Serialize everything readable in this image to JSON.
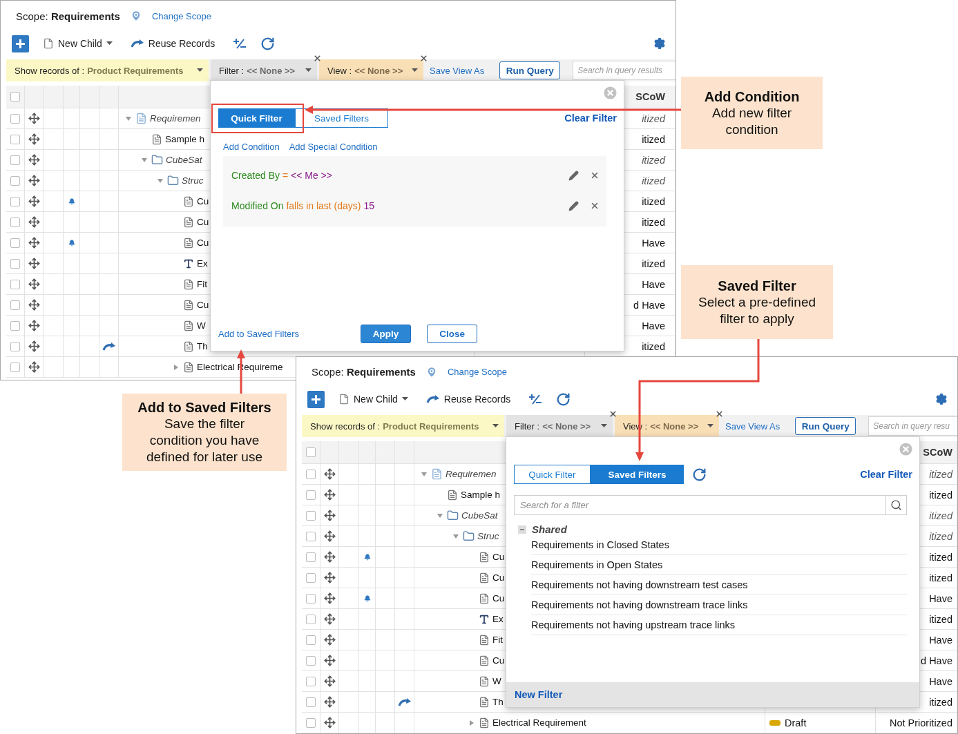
{
  "screens": [
    {
      "scope": "Scope: **Requirements**",
      "change_scope": "Change Scope",
      "new_child": "New Child",
      "reuse_records": "Reuse Records",
      "filter_bar": {
        "show_label": "Show records of :",
        "show_value": "Product Requirements",
        "filter_label": "Filter :",
        "filter_value": "<< None >>",
        "view_label": "View :",
        "view_value": "<< None >>",
        "save_view_as": "Save View As",
        "run_query": "Run Query",
        "search_placeholder": "Search in query results"
      },
      "select_all_checked": false,
      "column_header": "SCoW",
      "tree": [
        {
          "kind": "collection",
          "title": "Requiremen",
          "expanded": true,
          "checked": false,
          "priority": "itized",
          "children": [
            {
              "kind": "document",
              "title": "Sample h",
              "checked": false,
              "priority": "itized"
            },
            {
              "kind": "folder",
              "title": "CubeSat",
              "expanded": true,
              "checked": false,
              "priority": "itized",
              "children": [
                {
                  "kind": "folder",
                  "title": "Struc",
                  "expanded": true,
                  "checked": false,
                  "priority": "itized",
                  "children": [
                    {
                      "kind": "document",
                      "title": "Cu",
                      "checked": false,
                      "alert": true,
                      "priority": "itized"
                    },
                    {
                      "kind": "document",
                      "title": "Cu",
                      "checked": false,
                      "priority": "itized"
                    },
                    {
                      "kind": "document",
                      "title": "Cu",
                      "checked": false,
                      "alert": true,
                      "priority": "Have"
                    },
                    {
                      "kind": "text",
                      "title": "Ex",
                      "checked": false,
                      "priority": "itized"
                    },
                    {
                      "kind": "document",
                      "title": "Fit",
                      "checked": false,
                      "priority": "Have"
                    },
                    {
                      "kind": "document",
                      "title": "Cu",
                      "checked": false,
                      "priority": "d Have"
                    },
                    {
                      "kind": "document",
                      "title": "W",
                      "checked": false,
                      "priority": "Have"
                    },
                    {
                      "kind": "document",
                      "title": "Th",
                      "checked": false,
                      "reused": true,
                      "priority": "itized"
                    },
                    {
                      "kind": "document",
                      "title": "Electrical Requireme",
                      "expanded": false,
                      "checked": false
                    }
                  ]
                }
              ]
            }
          ]
        }
      ],
      "popup": {
        "kind": "quick",
        "tabs": [
          {
            "label": "Quick Filter",
            "selected": true
          },
          {
            "label": "Saved Filters",
            "selected": false
          }
        ],
        "clear_filter": "Clear Filter",
        "links": [
          "Add Condition",
          "Add Special Condition"
        ],
        "conditions": [
          {
            "field": "Created By",
            "operator": "=",
            "value": "<< Me >>"
          },
          {
            "field": "Modified On",
            "operator": "falls in last (days)",
            "value": "15"
          }
        ],
        "add_to_saved": "Add to Saved Filters",
        "buttons": [
          {
            "label": "Apply",
            "primary": true
          },
          {
            "label": "Close",
            "primary": false
          }
        ]
      }
    },
    {
      "scope": "Scope: **Requirements**",
      "change_scope": "Change Scope",
      "new_child": "New Child",
      "reuse_records": "Reuse Records",
      "filter_bar": {
        "show_label": "Show records of :",
        "show_value": "Product Requirements",
        "filter_label": "Filter :",
        "filter_value": "<< None >>",
        "view_label": "View :",
        "view_value": "<< None >>",
        "save_view_as": "Save View As",
        "run_query": "Run Query",
        "search_placeholder": "Search in query resu"
      },
      "select_all_checked": false,
      "column_header": "SCoW",
      "tree": [
        {
          "kind": "collection",
          "title": "Requiremen",
          "expanded": true,
          "checked": false,
          "priority": "itized",
          "children": [
            {
              "kind": "document",
              "title": "Sample h",
              "checked": false,
              "priority": "itized"
            },
            {
              "kind": "folder",
              "title": "CubeSat",
              "expanded": true,
              "checked": false,
              "priority": "itized",
              "children": [
                {
                  "kind": "folder",
                  "title": "Struc",
                  "expanded": true,
                  "checked": false,
                  "priority": "itized",
                  "children": [
                    {
                      "kind": "document",
                      "title": "Cu",
                      "checked": false,
                      "alert": true,
                      "priority": "itized"
                    },
                    {
                      "kind": "document",
                      "title": "Cu",
                      "checked": false,
                      "priority": "itized"
                    },
                    {
                      "kind": "document",
                      "title": "Cu",
                      "checked": false,
                      "alert": true,
                      "priority": "Have"
                    },
                    {
                      "kind": "text",
                      "title": "Ex",
                      "checked": false,
                      "priority": "itized"
                    },
                    {
                      "kind": "document",
                      "title": "Fit",
                      "checked": false,
                      "priority": "Have"
                    },
                    {
                      "kind": "document",
                      "title": "Cu",
                      "checked": false,
                      "priority": "d Have"
                    },
                    {
                      "kind": "document",
                      "title": "W",
                      "checked": false,
                      "priority": "Have"
                    },
                    {
                      "kind": "document",
                      "title": "Th",
                      "checked": false,
                      "reused": true,
                      "priority": "itized"
                    },
                    {
                      "kind": "document",
                      "title": "Electrical Requirement",
                      "expanded": false,
                      "checked": false,
                      "status": "Draft",
                      "priority": "Not Prioritized"
                    }
                  ]
                }
              ]
            }
          ]
        }
      ],
      "popup": {
        "kind": "saved",
        "tabs": [
          {
            "label": "Quick Filter",
            "selected": false
          },
          {
            "label": "Saved Filters",
            "selected": true
          }
        ],
        "clear_filter": "Clear Filter",
        "search_placeholder": "Search for a filter",
        "group": {
          "name": "Shared",
          "expanded": true,
          "items": [
            "Requirements in Closed States",
            "Requirements in Open States",
            "Requirements not having downstream test cases",
            "Requirements not having downstream trace links",
            "Requirements not having upstream trace links"
          ]
        },
        "new_filter": "New Filter"
      }
    }
  ],
  "callouts": [
    {
      "title": "Add Condition",
      "text": "Add new filter condition"
    },
    {
      "title": "Saved Filter",
      "text": "Select a pre-defined filter to apply"
    },
    {
      "title": "Add to Saved Filters",
      "text": "Save the filter condition you have defined for later use"
    }
  ]
}
